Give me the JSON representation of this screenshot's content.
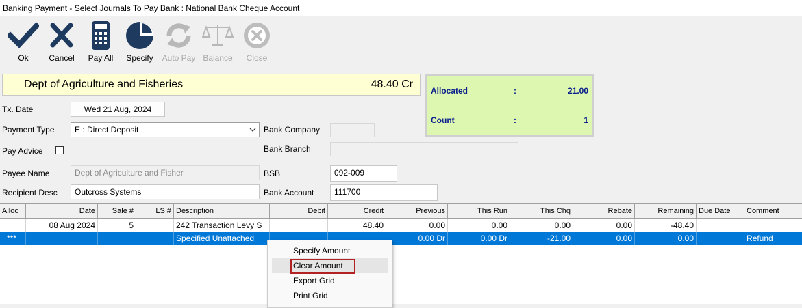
{
  "window": {
    "title": "Banking Payment - Select Journals To Pay   Bank : National Bank Cheque Account"
  },
  "toolbar": {
    "ok": "Ok",
    "cancel": "Cancel",
    "pay_all": "Pay All",
    "specify": "Specify",
    "auto_pay": "Auto Pay",
    "balance": "Balance",
    "close": "Close"
  },
  "payee_banner": {
    "name": "Dept of Agriculture and Fisheries",
    "amount": "48.40 Cr"
  },
  "summary": {
    "allocated_label": "Allocated",
    "allocated_sep": ":",
    "allocated_value": "21.00",
    "count_label": "Count",
    "count_sep": ":",
    "count_value": "1"
  },
  "form": {
    "tx_date_label": "Tx. Date",
    "tx_date_value": "Wed 21 Aug, 2024",
    "payment_type_label": "Payment Type",
    "payment_type_value": "E : Direct Deposit",
    "pay_advice_label": "Pay Advice",
    "payee_name_label": "Payee Name",
    "payee_name_value": "Dept of Agriculture and Fisher",
    "recipient_desc_label": "Recipient Desc",
    "recipient_desc_value": "Outcross Systems",
    "bank_company_label": "Bank Company",
    "bank_company_value": "",
    "bank_branch_label": "Bank Branch",
    "bank_branch_value": "",
    "bsb_label": "BSB",
    "bsb_value": "092-009",
    "bank_account_label": "Bank Account",
    "bank_account_value": "111700"
  },
  "grid": {
    "columns": [
      "Alloc",
      "Date",
      "Sale #",
      "LS #",
      "Description",
      "Debit",
      "Credit",
      "Previous",
      "This Run",
      "This Chq",
      "Rebate",
      "Remaining",
      "Due Date",
      "Comment"
    ],
    "rows": [
      {
        "alloc": "",
        "date": "08 Aug 2024",
        "sale": "5",
        "ls": "",
        "description": "242 Transaction Levy S",
        "debit": "",
        "credit": "48.40",
        "previous": "0.00",
        "this_run": "0.00",
        "this_chq": "0.00",
        "rebate": "0.00",
        "remaining": "-48.40",
        "due_date": "",
        "comment": ""
      },
      {
        "alloc": "***",
        "date": "",
        "sale": "",
        "ls": "",
        "description": "Specified Unattached",
        "debit": "",
        "credit": "",
        "previous": "0.00 Dr",
        "this_run": "0.00 Dr",
        "this_chq": "-21.00",
        "rebate": "0.00",
        "remaining": "0.00",
        "due_date": "",
        "comment": "Refund"
      }
    ]
  },
  "context_menu": {
    "items": [
      "Specify Amount",
      "Clear Amount",
      "Export Grid",
      "Print Grid"
    ],
    "highlighted": "Clear Amount"
  },
  "colors": {
    "selected_row": "#0078d7",
    "summary_bg": "#ddf6b0",
    "summary_text": "#0a1e8c",
    "banner_bg": "#ffffd4",
    "toolbar_icon": "#1f3a5f",
    "highlight_border": "#b22222"
  }
}
